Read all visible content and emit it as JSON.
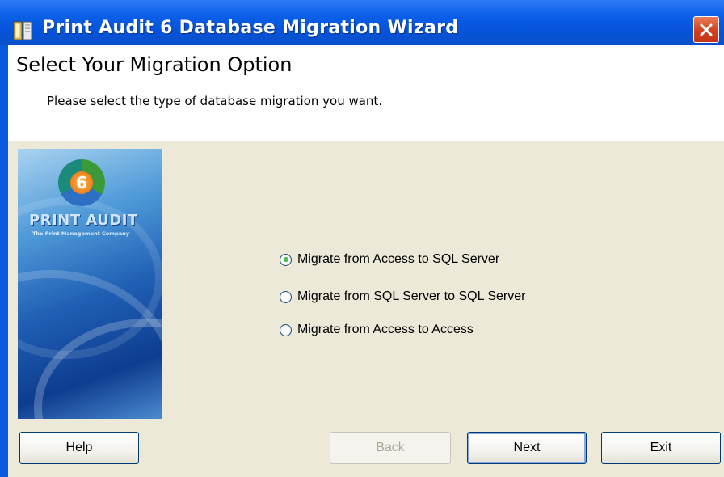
{
  "window": {
    "title": "Print Audit 6 Database Migration Wizard",
    "close_icon": "close-icon",
    "app_icon": "document-icon"
  },
  "header": {
    "title": "Select Your Migration Option",
    "subtitle": "Please select the type of database migration you want."
  },
  "banner": {
    "badge_number": "6",
    "logo_text": "PRINT AUDIT",
    "tagline": "The Print Management Company"
  },
  "options": [
    {
      "label": "Migrate from Access to SQL Server",
      "selected": true
    },
    {
      "label": "Migrate from SQL Server to SQL Server",
      "selected": false
    },
    {
      "label": "Migrate from Access to Access",
      "selected": false
    }
  ],
  "buttons": {
    "help": "Help",
    "back": "Back",
    "next": "Next",
    "exit": "Exit"
  },
  "colors": {
    "titlebar": "#0a5fe8",
    "body_bg": "#ece9d8",
    "close_button": "#d3411c"
  }
}
